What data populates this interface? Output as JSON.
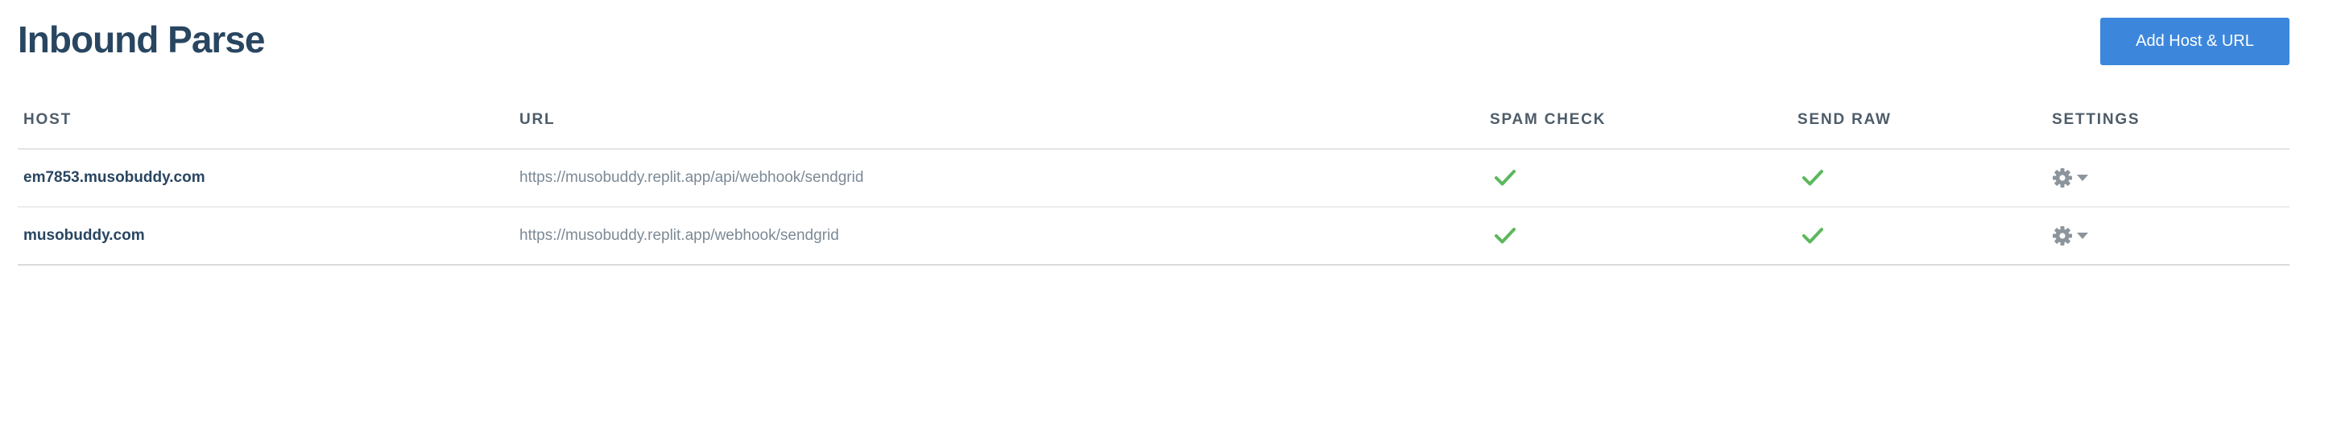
{
  "page": {
    "title": "Inbound Parse"
  },
  "toolbar": {
    "add_label": "Add Host & URL"
  },
  "table": {
    "headers": {
      "host": "HOST",
      "url": "URL",
      "spam_check": "SPAM CHECK",
      "send_raw": "SEND RAW",
      "settings": "SETTINGS"
    },
    "rows": [
      {
        "host": "em7853.musobuddy.com",
        "url": "https://musobuddy.replit.app/api/webhook/sendgrid",
        "spam_check": true,
        "send_raw": true
      },
      {
        "host": "musobuddy.com",
        "url": "https://musobuddy.replit.app/webhook/sendgrid",
        "spam_check": true,
        "send_raw": true
      }
    ]
  },
  "icons": {
    "check": "check-icon",
    "settings": "gear-icon",
    "dropdown": "caret-down-icon"
  },
  "colors": {
    "title": "#294661",
    "button_bg": "#3c87dc",
    "check": "#5cb85c",
    "gear": "#8c949c",
    "url_text": "#7c8a96"
  }
}
